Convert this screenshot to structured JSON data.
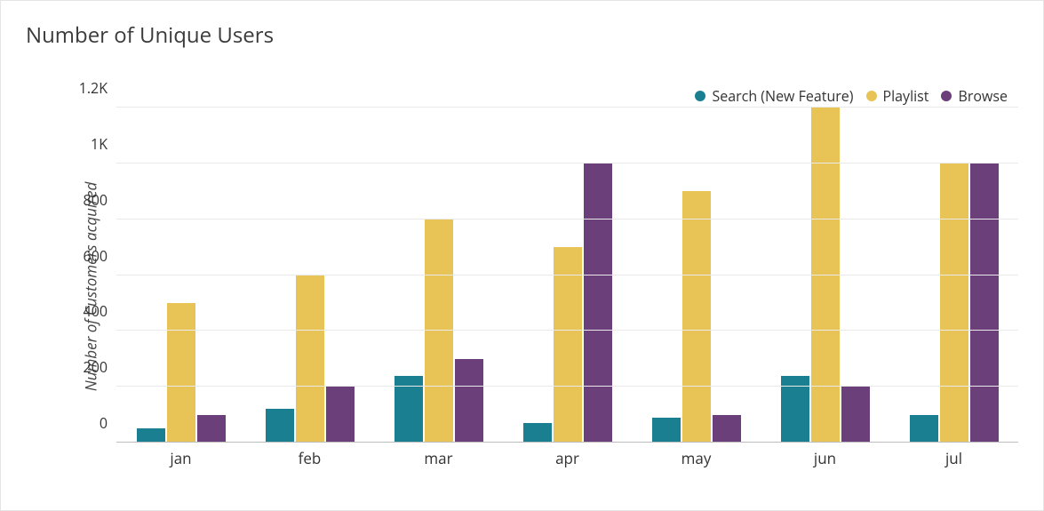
{
  "chart_data": {
    "type": "bar",
    "title": "Number of Unique Users",
    "ylabel": "Number of Customers acquired",
    "xlabel": "",
    "categories": [
      "jan",
      "feb",
      "mar",
      "apr",
      "may",
      "jun",
      "jul"
    ],
    "series": [
      {
        "name": "Search (New Feature)",
        "color": "#1a7f91",
        "values": [
          50,
          120,
          240,
          70,
          90,
          240,
          100
        ]
      },
      {
        "name": "Playlist",
        "color": "#e8c456",
        "values": [
          500,
          600,
          800,
          700,
          900,
          1200,
          1000
        ]
      },
      {
        "name": "Browse",
        "color": "#6a3f7a",
        "values": [
          100,
          200,
          300,
          1000,
          100,
          200,
          1000
        ]
      }
    ],
    "ylim": [
      0,
      1200
    ],
    "yticks": [
      {
        "v": 0,
        "label": "0"
      },
      {
        "v": 200,
        "label": "200"
      },
      {
        "v": 400,
        "label": "400"
      },
      {
        "v": 600,
        "label": "600"
      },
      {
        "v": 800,
        "label": "800"
      },
      {
        "v": 1000,
        "label": "1K"
      },
      {
        "v": 1200,
        "label": "1.2K"
      }
    ],
    "legend_position": "top-right"
  }
}
